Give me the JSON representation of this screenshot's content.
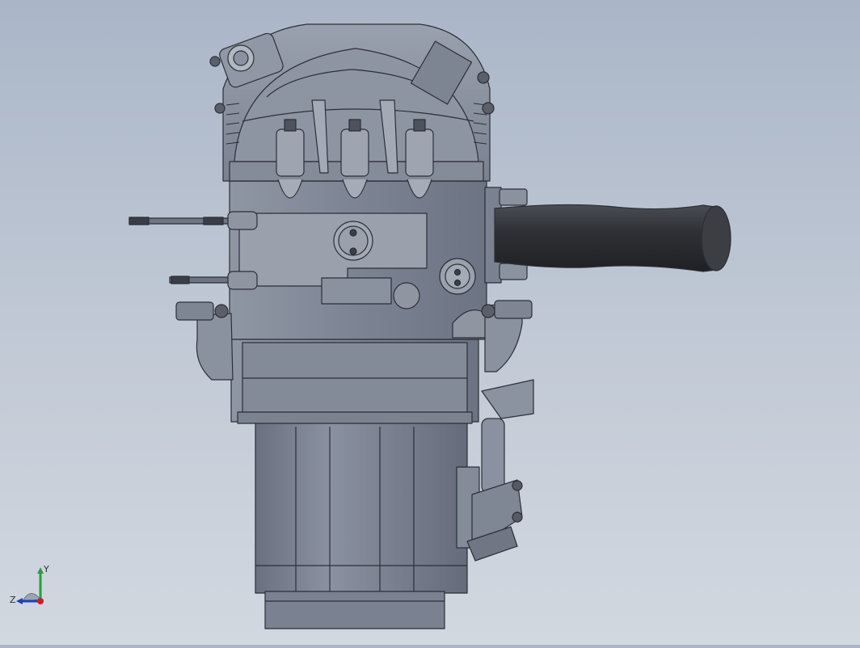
{
  "viewport": {
    "background_top": "#aab6c8",
    "background_bottom": "#d2d8e0",
    "model_color": "#7c8494",
    "model_highlight": "#aab0bc",
    "hose_color": "#2a2c30",
    "edge_color": "#2b2f37"
  },
  "triad": {
    "y_label": "Y",
    "z_label": "Z",
    "y_color": "#2e9a3c",
    "x_color": "#c8202a",
    "z_color": "#2040b0"
  }
}
